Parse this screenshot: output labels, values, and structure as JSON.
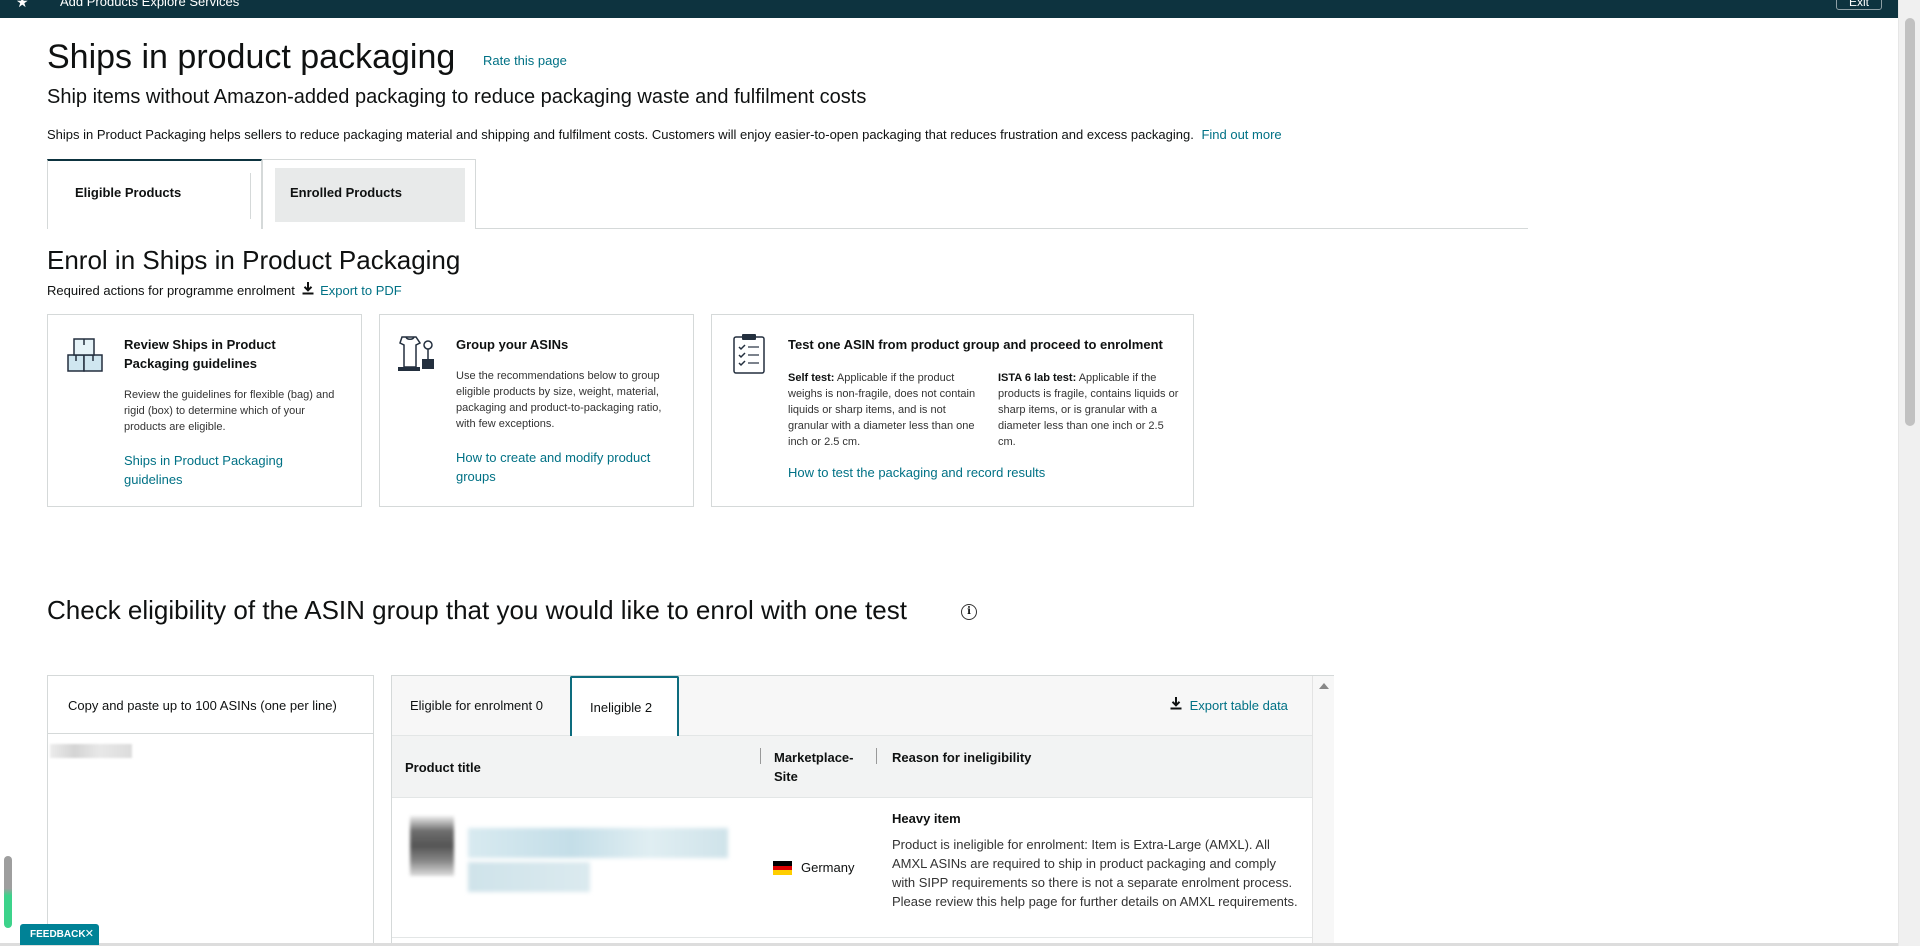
{
  "topbar": {
    "nav_text": "Add Products    Explore Services",
    "exit_label": "Exit"
  },
  "header": {
    "title": "Ships in product packaging",
    "rate_link": "Rate this page",
    "subtitle": "Ship items without Amazon-added packaging to reduce packaging waste and fulfilment costs",
    "intro": "Ships in Product Packaging helps sellers to reduce packaging material and shipping and fulfilment costs. Customers will enjoy easier-to-open packaging that reduces frustration and excess packaging.",
    "find_out_more": "Find out more"
  },
  "tabs": [
    {
      "label": "Eligible Products",
      "active": true
    },
    {
      "label": "Enrolled Products",
      "active": false
    }
  ],
  "enrol": {
    "title": "Enrol in Ships in Product Packaging",
    "required_actions": "Required actions for programme enrolment",
    "export_pdf": "Export to PDF",
    "cards": [
      {
        "icon": "boxes-icon",
        "title": "Review Ships in Product Packaging guidelines",
        "text": "Review the guidelines for flexible (bag) and rigid (box) to determine which of your products are eligible.",
        "link": "Ships in Product Packaging guidelines"
      },
      {
        "icon": "product-group-icon",
        "title": "Group your ASINs",
        "text": "Use the recommendations below to group eligible products by size, weight, material, packaging and product-to-packaging ratio, with few exceptions.",
        "link": "How to create and modify product groups"
      },
      {
        "icon": "clipboard-checklist-icon",
        "title": "Test one ASIN from product group and proceed to enrolment",
        "self_test_label": "Self test:",
        "self_test_text": "Applicable if the product weighs is non-fragile, does not contain liquids or sharp items, and is not granular with a diameter less than one inch or 2.5 cm.",
        "ista_label": "ISTA 6 lab test:",
        "ista_text": "Applicable if the products is fragile, contains liquids or sharp items, or is granular with a diameter less than one inch or 2.5 cm.",
        "link": "How to test the packaging and record results"
      }
    ]
  },
  "eligibility": {
    "title": "Check eligibility of the ASIN group that you would like to enrol with one test",
    "asin_input_label": "Copy and paste up to 100 ASINs (one per line)",
    "result_tabs": [
      {
        "label": "Eligible for enrolment 0",
        "active": false
      },
      {
        "label": "Ineligible 2",
        "active": true
      }
    ],
    "export_table": "Export table data",
    "columns": [
      "Product title",
      "Marketplace-Site",
      "Reason for ineligibility"
    ],
    "rows": [
      {
        "marketplace": "Germany",
        "reason_title": "Heavy item",
        "reason_text": "Product is ineligible for enrolment: Item is Extra-Large (AMXL). All AMXL ASINs are required to ship in product packaging and comply with SIPP requirements so there is not a separate enrolment process. Please review this help page for further details on AMXL requirements."
      }
    ]
  },
  "feedback": {
    "label": "FEEDBACK",
    "close": "✕"
  },
  "colors": {
    "topbar": "#0d333f",
    "link": "#007185",
    "active_tab_border": "#0d6c7e",
    "feedback_bg": "#008296"
  }
}
